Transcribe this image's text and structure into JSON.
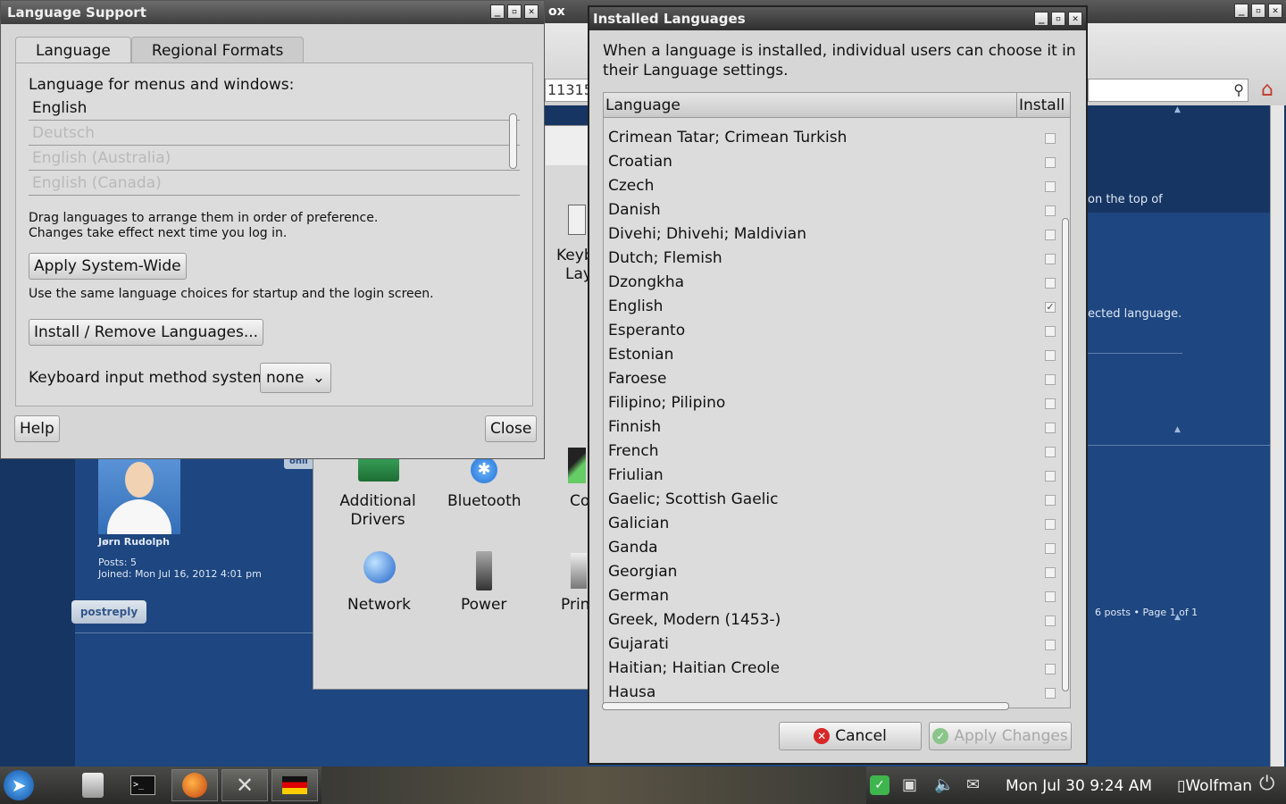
{
  "browser": {
    "title_fragment": "ox",
    "url_fragment": "11315",
    "forum": {
      "right_text_1": "on the top of",
      "right_text_2": "ected language.",
      "user": "Jørn Rudolph",
      "posts": "Posts: 5",
      "joined": "Joined: Mon Jul 16, 2012 4:01 pm",
      "postreply": "postreply",
      "posts_count": "6 posts • Page 1 of 1",
      "badge": "onli"
    }
  },
  "settings": {
    "keyboard_label_1": "Keyb",
    "keyboard_label_2": "Lay",
    "additional_drivers_1": "Additional",
    "additional_drivers_2": "Drivers",
    "bluetooth": "Bluetooth",
    "co": "Co",
    "network": "Network",
    "power": "Power",
    "prin": "Prin"
  },
  "language_support": {
    "title": "Language Support",
    "tabs": [
      "Language",
      "Regional Formats"
    ],
    "menus_label": "Language for menus and windows:",
    "languages": [
      "English",
      "Deutsch",
      "English (Australia)",
      "English (Canada)"
    ],
    "drag_hint_1": "Drag languages to arrange them in order of preference.",
    "drag_hint_2": "Changes take effect next time you log in.",
    "apply_system_wide": "Apply System-Wide",
    "apply_hint": "Use the same language choices for startup and the login screen.",
    "install_remove": "Install / Remove Languages...",
    "keyboard_label": "Keyboard input method system:",
    "keyboard_value": "none",
    "help": "Help",
    "close": "Close"
  },
  "installed_languages": {
    "title": "Installed Languages",
    "description": "When a language is installed, individual users can choose it in their Language settings.",
    "col_language": "Language",
    "col_install": "Install",
    "rows": [
      {
        "name": "Crimean Tatar; Crimean Turkish",
        "installed": false
      },
      {
        "name": "Croatian",
        "installed": false
      },
      {
        "name": "Czech",
        "installed": false
      },
      {
        "name": "Danish",
        "installed": false
      },
      {
        "name": "Divehi; Dhivehi; Maldivian",
        "installed": false
      },
      {
        "name": "Dutch; Flemish",
        "installed": false
      },
      {
        "name": "Dzongkha",
        "installed": false
      },
      {
        "name": "English",
        "installed": true
      },
      {
        "name": "Esperanto",
        "installed": false
      },
      {
        "name": "Estonian",
        "installed": false
      },
      {
        "name": "Faroese",
        "installed": false
      },
      {
        "name": "Filipino; Pilipino",
        "installed": false
      },
      {
        "name": "Finnish",
        "installed": false
      },
      {
        "name": "French",
        "installed": false
      },
      {
        "name": "Friulian",
        "installed": false
      },
      {
        "name": "Gaelic; Scottish Gaelic",
        "installed": false
      },
      {
        "name": "Galician",
        "installed": false
      },
      {
        "name": "Ganda",
        "installed": false
      },
      {
        "name": "Georgian",
        "installed": false
      },
      {
        "name": "German",
        "installed": false
      },
      {
        "name": "Greek, Modern (1453-)",
        "installed": false
      },
      {
        "name": "Gujarati",
        "installed": false
      },
      {
        "name": "Haitian; Haitian Creole",
        "installed": false
      },
      {
        "name": "Hausa",
        "installed": false
      }
    ],
    "cancel": "Cancel",
    "apply_changes": "Apply Changes"
  },
  "taskbar": {
    "clock": "Mon Jul 30  9:24 AM",
    "user": "Wolfman"
  }
}
